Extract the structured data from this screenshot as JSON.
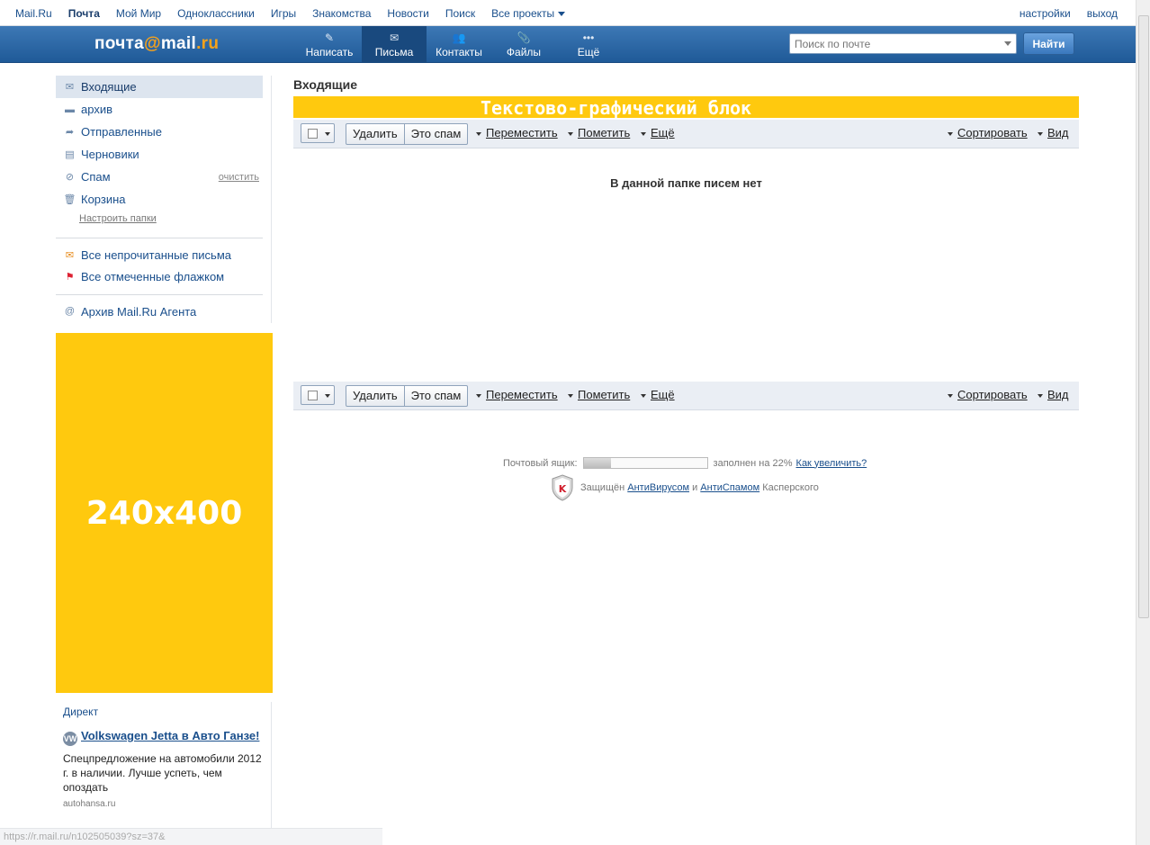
{
  "topnav": {
    "items": [
      "Mail.Ru",
      "Почта",
      "Мой Мир",
      "Одноклассники",
      "Игры",
      "Знакомства",
      "Новости",
      "Поиск",
      "Все проекты"
    ],
    "settings": "настройки",
    "logout": "выход"
  },
  "header": {
    "logo_main": "почта",
    "logo_at": "@",
    "logo_mail": "mail",
    "logo_dot": ".ru",
    "buttons": [
      "Написать",
      "Письма",
      "Контакты",
      "Файлы",
      "Ещё"
    ],
    "search_placeholder": "Поиск по почте",
    "find_label": "Найти"
  },
  "sidebar": {
    "folders": [
      "Входящие",
      "архив",
      "Отправленные",
      "Черновики",
      "Спам",
      "Корзина"
    ],
    "clean_label": "очистить",
    "configure": "Настроить папки",
    "filters": [
      "Все непрочитанные письма",
      "Все отмеченные флажком"
    ],
    "agent_archive": "Архив Mail.Ru Агента"
  },
  "banner": {
    "side": "240x400",
    "top": "Текстово-графический блок"
  },
  "direct": {
    "title": "Директ",
    "ad_title": "Volkswagen Jetta в Авто Ганзе!",
    "ad_text": "Спецпредложение на автомобили 2012 г. в наличии. Лучше успеть, чем опоздать",
    "ad_site": "autohansa.ru"
  },
  "status_url": "https://r.mail.ru/n102505039?sz=37&",
  "main": {
    "title": "Входящие",
    "toolbar": {
      "delete": "Удалить",
      "spam": "Это спам",
      "move": "Переместить",
      "mark": "Пометить",
      "more": "Ещё",
      "sort": "Сортировать",
      "view": "Вид"
    },
    "empty_text": "В данной папке писем нет",
    "quota": {
      "label": "Почтовый ящик:",
      "filled": "заполнен на 22%",
      "percent": 22,
      "link": "Как увеличить?"
    },
    "kaspersky": {
      "prefix": "Защищён",
      "antivirus": "АнтиВирусом",
      "and": "и",
      "antispam": "АнтиСпамом",
      "suffix": "Касперского"
    }
  },
  "colors": {
    "header_blue": "#2a67a6",
    "banner_yellow": "#ffc90e",
    "link_blue": "#1a4f8c"
  }
}
